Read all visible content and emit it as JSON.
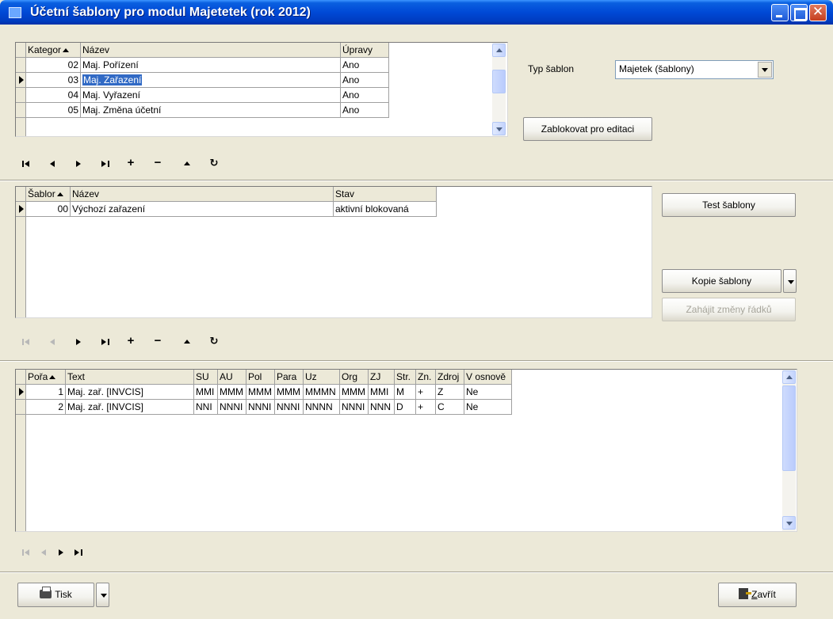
{
  "window": {
    "title": "Účetní šablony pro modul Majetetek (rok 2012)"
  },
  "categories": {
    "columns": [
      "Kategor",
      "Název",
      "Úpravy"
    ],
    "rows": [
      {
        "kategorie": "02",
        "nazev": "Maj. Pořízení",
        "upravy": "Ano"
      },
      {
        "kategorie": "03",
        "nazev": "Maj. Zařazení",
        "upravy": "Ano"
      },
      {
        "kategorie": "04",
        "nazev": "Maj. Vyřazení",
        "upravy": "Ano"
      },
      {
        "kategorie": "05",
        "nazev": "Maj. Změna účetní",
        "upravy": "Ano"
      }
    ]
  },
  "typ_sablon": {
    "label": "Typ šablon",
    "value": "Majetek (šablony)"
  },
  "buttons": {
    "zablokovat": "Zablokovat pro editaci",
    "test": "Test šablony",
    "kopie": "Kopie šablony",
    "zahajit": "Zahájit změny řádků",
    "tisk": "Tisk",
    "zavrit_u": "Z",
    "zavrit_rest": "avřít"
  },
  "templates": {
    "columns": [
      "Šablor",
      "Název",
      "Stav"
    ],
    "rows": [
      {
        "sablona": "00",
        "nazev": "Výchozí zařazení",
        "stav": "aktivní blokovaná"
      }
    ]
  },
  "lines": {
    "columns": [
      "Pořa",
      "Text",
      "SU",
      "AU",
      "Pol",
      "Para",
      "Uz",
      "Org",
      "ZJ",
      "Str.",
      "Zn.",
      "Zdroj",
      "V osnově"
    ],
    "rows": [
      {
        "pora": "1",
        "text": "Maj. zař. [INVCIS]",
        "su": "MMI",
        "au": "MMM",
        "pol": "MMM",
        "para": "MMM",
        "uz": "MMMN",
        "org": "MMM",
        "zj": "MMI",
        "str": "M",
        "zn": "+",
        "zdroj": "Z",
        "osnova": "Ne"
      },
      {
        "pora": "2",
        "text": "Maj. zař. [INVCIS]",
        "su": "NNI",
        "au": "NNNI",
        "pol": "NNNI",
        "para": "NNNI",
        "uz": "NNNN",
        "org": "NNNI",
        "zj": "NNN",
        "str": "D",
        "zn": "+",
        "zdroj": "C",
        "osnova": "Ne"
      }
    ]
  }
}
